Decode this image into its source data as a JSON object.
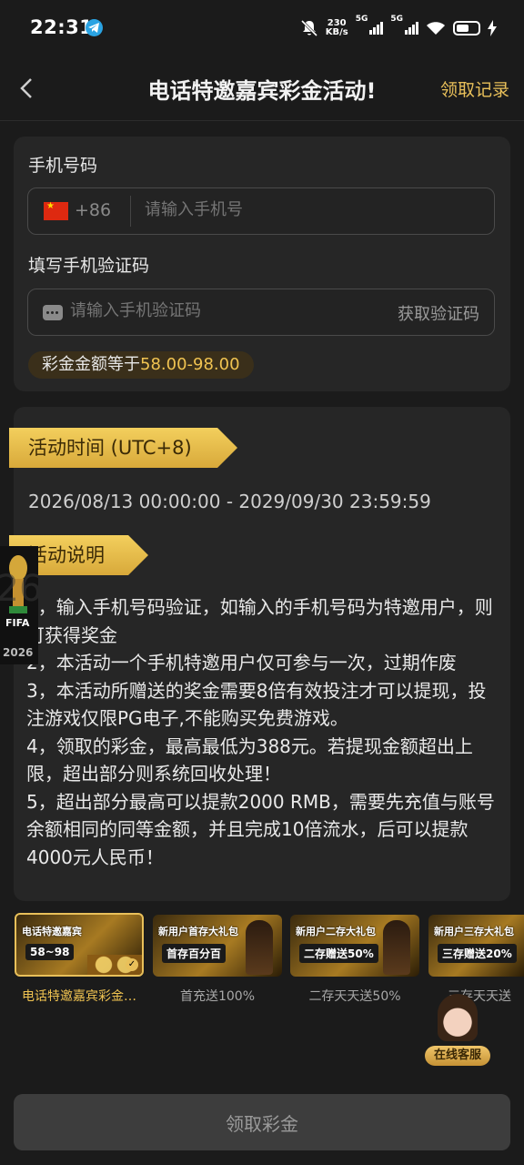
{
  "status_bar": {
    "time": "22:31",
    "network_speed_value": "230",
    "network_speed_unit": "KB/s",
    "signal1_label": "5G",
    "signal2_label": "5G",
    "battery_fraction": 0.6
  },
  "header": {
    "title": "电话特邀嘉宾彩金活动!",
    "records_link": "领取记录"
  },
  "form": {
    "phone_label": "手机号码",
    "country_code": "+86",
    "phone_placeholder": "请输入手机号",
    "code_label": "填写手机验证码",
    "code_placeholder": "请输入手机验证码",
    "get_code_label": "获取验证码",
    "amount_prefix": "彩金金额等于",
    "amount_value": "58.00-98.00"
  },
  "activity": {
    "time_heading": "活动时间 (UTC+8)",
    "time_range": "2026/08/13 00:00:00 - 2029/09/30 23:59:59",
    "desc_heading": "活动说明",
    "rules": [
      "1，输入手机号码验证，如输入的手机号码为特邀用户，则可获得奖金",
      "2，本活动一个手机特邀用户仅可参与一次，过期作废",
      "3，本活动所赠送的奖金需要8倍有效投注才可以提现，投注游戏仅限PG电子,不能购买免费游戏。",
      "4，领取的彩金，最高最低为388元。若提现金额超出上限，超出部分则系统回收处理！",
      "5，超出部分最高可以提款2000 RMB，需要先充值与账号余额相同的同等金额，并且完成10倍流水，后可以提款4000元人民币！"
    ]
  },
  "fifa_badge": {
    "text": "FIFA",
    "year": "2026"
  },
  "promos": [
    {
      "banner_title": "电话特邀嘉宾",
      "banner_sub": "58~98",
      "label": "电话特邀嘉宾彩金…",
      "active": true
    },
    {
      "banner_title": "新用户首存大礼包",
      "banner_sub": "首存百分百",
      "label": "首充送100%",
      "active": false
    },
    {
      "banner_title": "新用户二存大礼包",
      "banner_sub": "二存赠送50%",
      "label": "二存天天送50%",
      "active": false
    },
    {
      "banner_title": "新用户三存大礼包",
      "banner_sub": "三存赠送20%",
      "label": "三存天天送",
      "active": false
    }
  ],
  "customer_service": {
    "label": "在线客服"
  },
  "bottom": {
    "claim_button": "领取彩金"
  },
  "colors": {
    "accent_gold": "#e9c05a",
    "amount_gold": "#f0c351",
    "background": "#1b1b1b",
    "card": "#262626",
    "button_disabled": "#3d3d3d"
  }
}
